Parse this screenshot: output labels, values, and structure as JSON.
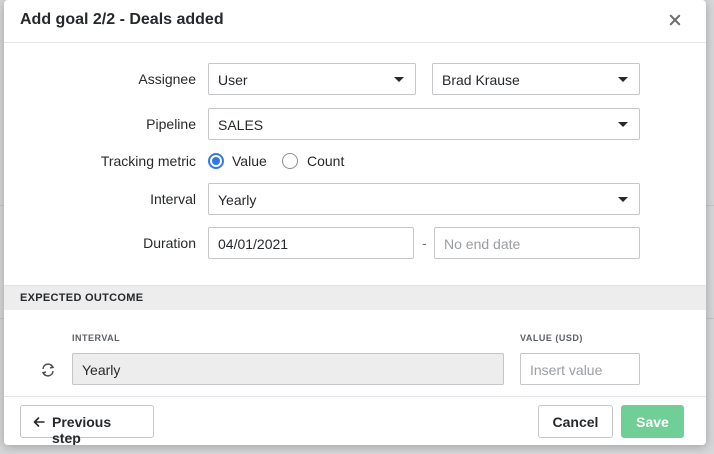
{
  "dialog": {
    "title": "Add goal 2/2 - Deals added",
    "close_icon": "close-icon"
  },
  "form": {
    "assignee": {
      "label": "Assignee",
      "type_value": "User",
      "user_value": "Brad Krause"
    },
    "pipeline": {
      "label": "Pipeline",
      "value": "SALES"
    },
    "tracking_metric": {
      "label": "Tracking metric",
      "options": [
        {
          "label": "Value",
          "selected": true
        },
        {
          "label": "Count",
          "selected": false
        }
      ]
    },
    "interval": {
      "label": "Interval",
      "value": "Yearly"
    },
    "duration": {
      "label": "Duration",
      "start_value": "04/01/2021",
      "separator": "-",
      "end_placeholder": "No end date"
    }
  },
  "expected_outcome": {
    "section_title": "EXPECTED OUTCOME",
    "interval_header": "INTERVAL",
    "value_header": "VALUE (USD)",
    "interval_value": "Yearly",
    "value_placeholder": "Insert value",
    "refresh_icon": "refresh-icon"
  },
  "footer": {
    "previous_label": "Previous step",
    "cancel_label": "Cancel",
    "save_label": "Save"
  },
  "colors": {
    "accent": "#317ae2",
    "save_button": "#6fcf97",
    "section_bar": "#ededee"
  }
}
